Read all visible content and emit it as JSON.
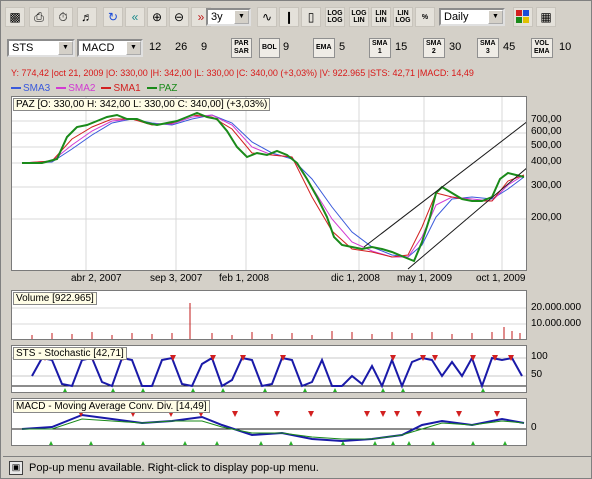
{
  "toolbar": {
    "period": "3y",
    "interval": "Daily",
    "scale_buttons": [
      {
        "top": "LOG",
        "bottom": "LOG"
      },
      {
        "top": "LOG",
        "bottom": "LIN"
      },
      {
        "top": "LIN",
        "bottom": "LIN"
      },
      {
        "top": "LIN",
        "bottom": "LOG"
      },
      {
        "top": "%",
        "bottom": ""
      }
    ]
  },
  "indicators": {
    "symbol": "STS",
    "oscillator": "MACD",
    "macd_params": [
      "12",
      "26",
      "9"
    ],
    "par_sar_top": "PAR",
    "par_sar_bottom": "SAR",
    "bol_label": "BOL",
    "bol_value": "9",
    "ema_label": "EMA",
    "ema_value": "5",
    "sma1_top": "SMA",
    "sma1_bottom": "1",
    "sma1_value": "15",
    "sma2_top": "SMA",
    "sma2_bottom": "2",
    "sma2_value": "30",
    "sma3_top": "SMA",
    "sma3_bottom": "3",
    "sma3_value": "45",
    "vol_top": "VOL",
    "vol_bottom": "EMA",
    "vol_value": "10"
  },
  "info_line": "Y: 774,42 |oct 21, 2009 |O: 330,00 |H: 342,00 |L: 330,00 |C: 340,00 (+3,03%) |V: 922.965 |STS: 42,71 |MACD: 14,49",
  "legend": [
    {
      "name": "SMA3",
      "color": "#3a5adb"
    },
    {
      "name": "SMA2",
      "color": "#d23ad2"
    },
    {
      "name": "SMA1",
      "color": "#d22020"
    },
    {
      "name": "PAZ",
      "color": "#1a8a1a"
    }
  ],
  "price_panel_label": "PAZ [O: 330,00  H: 342,00  L: 330,00  C: 340,00] (+3,03%)",
  "price_axis": [
    "700,00",
    "600,00",
    "500,00",
    "400,00",
    "300,00",
    "200,00"
  ],
  "x_axis": [
    "abr 2, 2007",
    "sep 3, 2007",
    "feb 1, 2008",
    "dic 1, 2008",
    "may 1, 2009",
    "oct 1, 2009"
  ],
  "volume_label": "Volume [922.965]",
  "volume_axis": [
    "20.000.000",
    "10.000.000"
  ],
  "sts_label": "STS - Stochastic [42,71]",
  "sts_axis": [
    "100",
    "50"
  ],
  "macd_label": "MACD - Moving Average Conv. Div. [14,49]",
  "macd_axis": [
    "0"
  ],
  "status_text": "Pop-up menu available. Right-click to display pop-up menu.",
  "icons": [
    "page-icon",
    "print-icon",
    "timer-icon",
    "sound-icon",
    "refresh-icon",
    "rewind-icon",
    "zoom-in-icon",
    "zoom-out-icon",
    "fast-forward-icon",
    "line-chart-icon",
    "bar-chart-icon",
    "candle-chart-icon",
    "color-grid-icon",
    "chart-window-icon"
  ]
}
